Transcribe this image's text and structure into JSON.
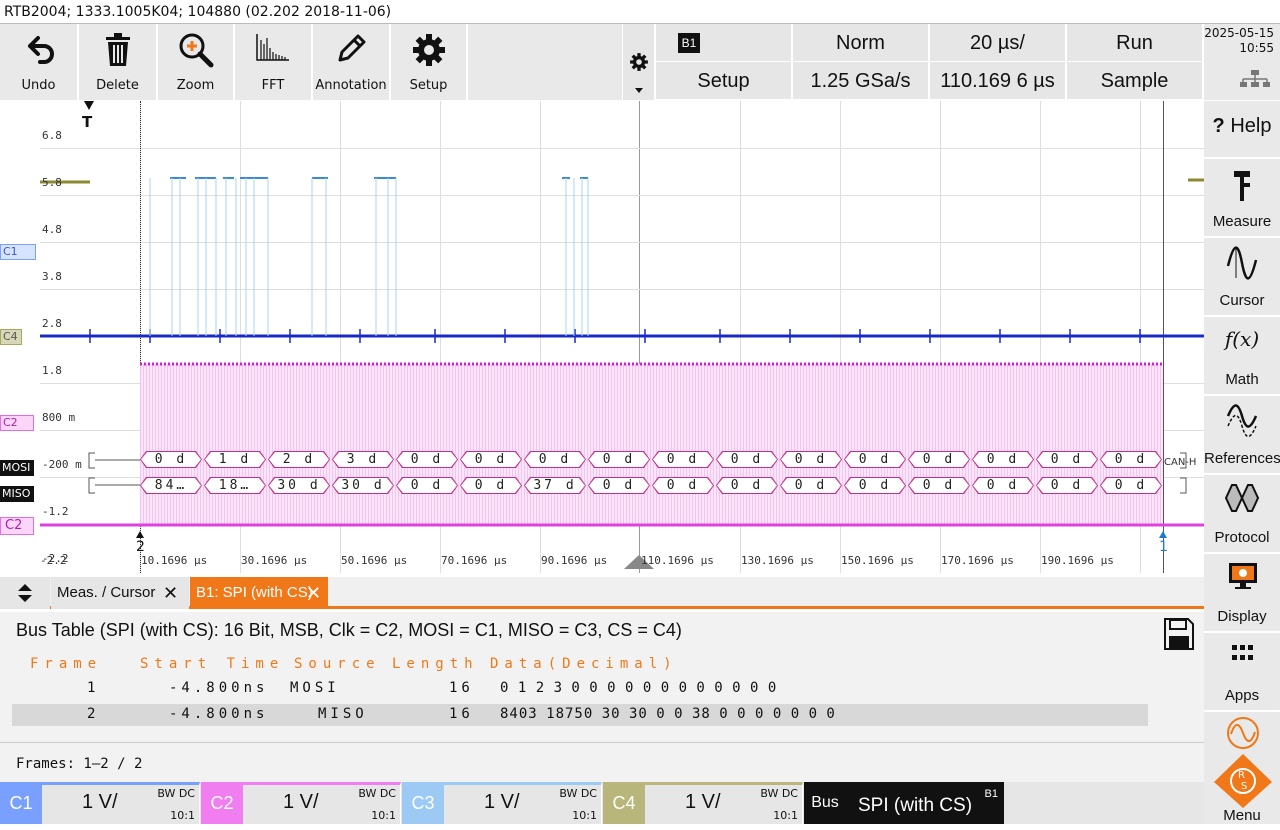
{
  "title": "RTB2004; 1333.1005K04; 104880 (02.202 2018-11-06)",
  "toolbar": {
    "undo": "Undo",
    "delete": "Delete",
    "zoom": "Zoom",
    "fft": "FFT",
    "annotation": "Annotation",
    "setup": "Setup"
  },
  "trigger_panel": {
    "bus_badge": "B1",
    "mode": "Norm",
    "timebase": "20 µs/",
    "run_state": "Run",
    "setup_label": "Setup",
    "sample_rate": "1.25 GSa/s",
    "position": "110.169 6 µs",
    "acq_mode": "Sample"
  },
  "clock": {
    "date": "2025-05-15",
    "time": "10:55"
  },
  "sidebar": {
    "help": "Help",
    "measure": "Measure",
    "cursor": "Cursor",
    "math": "Math",
    "math_glyph": "f(x)",
    "references": "References",
    "protocol": "Protocol",
    "display": "Display",
    "apps": "Apps",
    "menu": "Menu"
  },
  "plot": {
    "y_labels": [
      "6.8",
      "5.8",
      "4.8",
      "3.8",
      "2.8",
      "1.8",
      "800 m",
      "-200 m",
      "-1.2",
      "-2.2"
    ],
    "x_labels": [
      "10.1696 µs",
      "30.1696 µs",
      "50.1696 µs",
      "70.1696 µs",
      "90.1696 µs",
      "110.1696 µs",
      "130.1696 µs",
      "150.1696 µs",
      "170.1696 µs",
      "190.1696 µs"
    ],
    "trigger_marker": "T",
    "marker_left": "2",
    "marker_right": "1",
    "channel_tags": {
      "c1": "C1",
      "c4": "C4",
      "c2": "C2",
      "mosi": "MOSI",
      "miso": "MISO",
      "c2_bottom": "C2"
    },
    "can_label": "CAN-H",
    "mosi_frames": [
      "0 d",
      "1 d",
      "2 d",
      "3 d",
      "0 d",
      "0 d",
      "0 d",
      "0 d",
      "0 d",
      "0 d",
      "0 d",
      "0 d",
      "0 d",
      "0 d",
      "0 d",
      "0 d"
    ],
    "miso_frames": [
      "84…",
      "18…",
      "30 d",
      "30 d",
      "0 d",
      "0 d",
      "37 d",
      "0 d",
      "0 d",
      "0 d",
      "0 d",
      "0 d",
      "0 d",
      "0 d",
      "0 d",
      "0 d"
    ]
  },
  "tabs": {
    "meas_cursor": "Meas. / Cursor",
    "spi": "B1: SPI (with CS)"
  },
  "bus_table": {
    "heading": "Bus Table (SPI (with CS): 16 Bit, MSB, Clk = C2, MOSI = C1, MISO = C3, CS = C4)",
    "columns": [
      "Frame",
      "Start Time",
      "Source",
      "Length",
      "Data(Decimal)"
    ],
    "rows": [
      {
        "frame": "1",
        "start": "-4.800ns",
        "source": "MOSI",
        "length": "16",
        "data": "0  1  2  3  0  0  0  0  0  0  0  0  0  0  0  0"
      },
      {
        "frame": "2",
        "start": "-4.800ns",
        "source": "MISO",
        "length": "16",
        "data": "8403  18750  30  30  0  0  38  0  0  0  0  0  0  0"
      }
    ],
    "frames_summary": "Frames:  1–2 / 2"
  },
  "channels": [
    {
      "tag": "C1",
      "scale": "1 V/",
      "bw": "BW DC",
      "probe": "10:1",
      "color": "#7aa0ff"
    },
    {
      "tag": "C2",
      "scale": "1 V/",
      "bw": "BW DC",
      "probe": "10:1",
      "color": "#f07ef0"
    },
    {
      "tag": "C3",
      "scale": "1 V/",
      "bw": "BW DC",
      "probe": "10:1",
      "color": "#9ccaf5"
    },
    {
      "tag": "C4",
      "scale": "1 V/",
      "bw": "BW DC",
      "probe": "10:1",
      "color": "#b8b67a"
    }
  ],
  "bus": {
    "tag": "Bus",
    "value": "SPI (with CS)",
    "badge": "B1"
  }
}
